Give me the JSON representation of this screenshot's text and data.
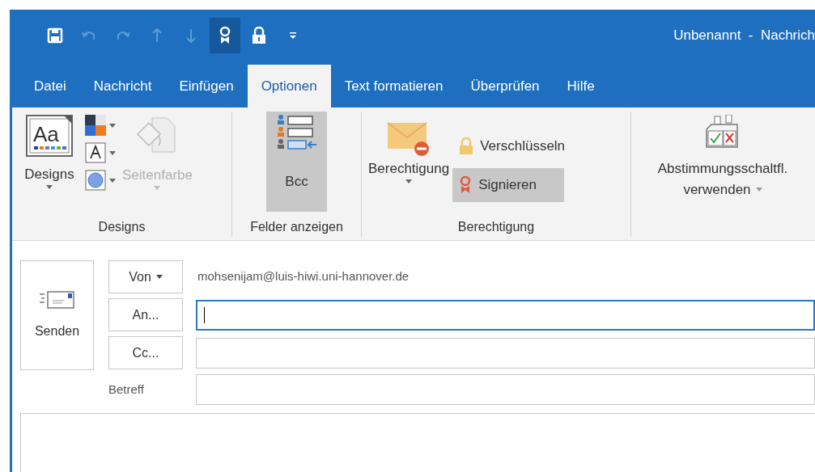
{
  "window": {
    "title": "Unbenannt  -  Nachrich"
  },
  "quick_access": [
    {
      "kind": "save",
      "disabled": false,
      "pressed": false
    },
    {
      "kind": "undo",
      "disabled": true,
      "pressed": false
    },
    {
      "kind": "redo",
      "disabled": true,
      "pressed": false
    },
    {
      "kind": "up",
      "disabled": true,
      "pressed": false
    },
    {
      "kind": "down",
      "disabled": true,
      "pressed": false
    },
    {
      "kind": "sign",
      "disabled": false,
      "pressed": true
    },
    {
      "kind": "lock",
      "disabled": false,
      "pressed": false
    },
    {
      "kind": "customize",
      "disabled": false,
      "pressed": false
    }
  ],
  "tabs": [
    {
      "label": "Datei",
      "selected": false
    },
    {
      "label": "Nachricht",
      "selected": false
    },
    {
      "label": "Einfügen",
      "selected": false
    },
    {
      "label": "Optionen",
      "selected": true
    },
    {
      "label": "Text formatieren",
      "selected": false
    },
    {
      "label": "Überprüfen",
      "selected": false
    },
    {
      "label": "Hilfe",
      "selected": false
    }
  ],
  "designs_group": {
    "label": "Designs",
    "icon_text": "Aa",
    "designs_button": "Designs",
    "page_color": {
      "label": "Seitenfarbe",
      "disabled": true
    }
  },
  "show_fields_group": {
    "label": "Felder anzeigen",
    "bcc": {
      "label": "Bcc",
      "pressed": true
    }
  },
  "permission_group": {
    "label": "Berechtigung",
    "permission_button": "Berechtigung",
    "encrypt": {
      "label": "Verschlüsseln",
      "pressed": false
    },
    "sign": {
      "label": "Signieren",
      "pressed": true
    }
  },
  "voting_group": {
    "button_lines": [
      "Abstimmungsschaltfl.",
      "verwenden"
    ]
  },
  "compose": {
    "send": "Senden",
    "from_button": "Von",
    "from_address": "mohsenijam@luis-hiwi.uni-hannover.de",
    "to_button": "An...",
    "cc_button": "Cc...",
    "subject_label": "Betreff",
    "to_field": {
      "focused": true
    },
    "cc_field": {
      "focused": false
    },
    "subject_field": {
      "focused": false
    }
  }
}
